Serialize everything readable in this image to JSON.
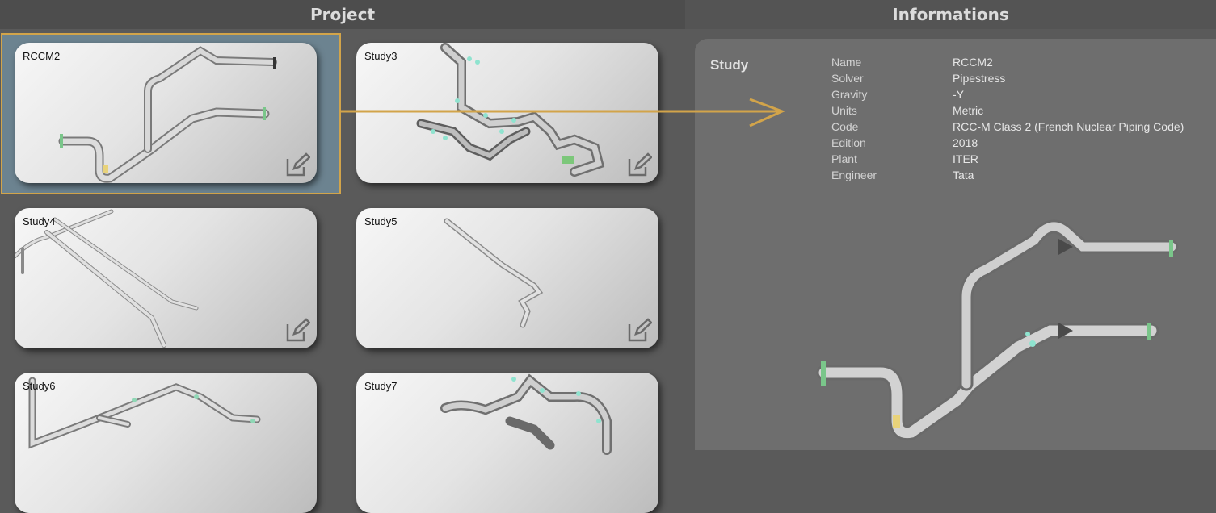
{
  "header": {
    "project_title": "Project",
    "info_title": "Informations"
  },
  "studies": [
    {
      "name": "RCCM2",
      "selected": true
    },
    {
      "name": "Study3",
      "selected": false
    },
    {
      "name": "Study4",
      "selected": false
    },
    {
      "name": "Study5",
      "selected": false
    },
    {
      "name": "Study6",
      "selected": false
    },
    {
      "name": "Study7",
      "selected": false
    }
  ],
  "info": {
    "section_label": "Study",
    "properties": [
      {
        "key": "Name",
        "value": "RCCM2"
      },
      {
        "key": "Solver",
        "value": "Pipestress"
      },
      {
        "key": "Gravity",
        "value": "-Y"
      },
      {
        "key": "Units",
        "value": "Metric"
      },
      {
        "key": "Code",
        "value": "RCC-M Class 2 (French Nuclear Piping Code)"
      },
      {
        "key": "Edition",
        "value": "2018"
      },
      {
        "key": "Plant",
        "value": "ITER"
      },
      {
        "key": "Engineer",
        "value": "Tata"
      }
    ]
  },
  "icons": {
    "edit": "edit-icon",
    "arrow": "arrow-right-icon"
  },
  "colors": {
    "accent": "#d2a44a",
    "panel": "#6e6e6e",
    "background": "#5a5a5a"
  }
}
